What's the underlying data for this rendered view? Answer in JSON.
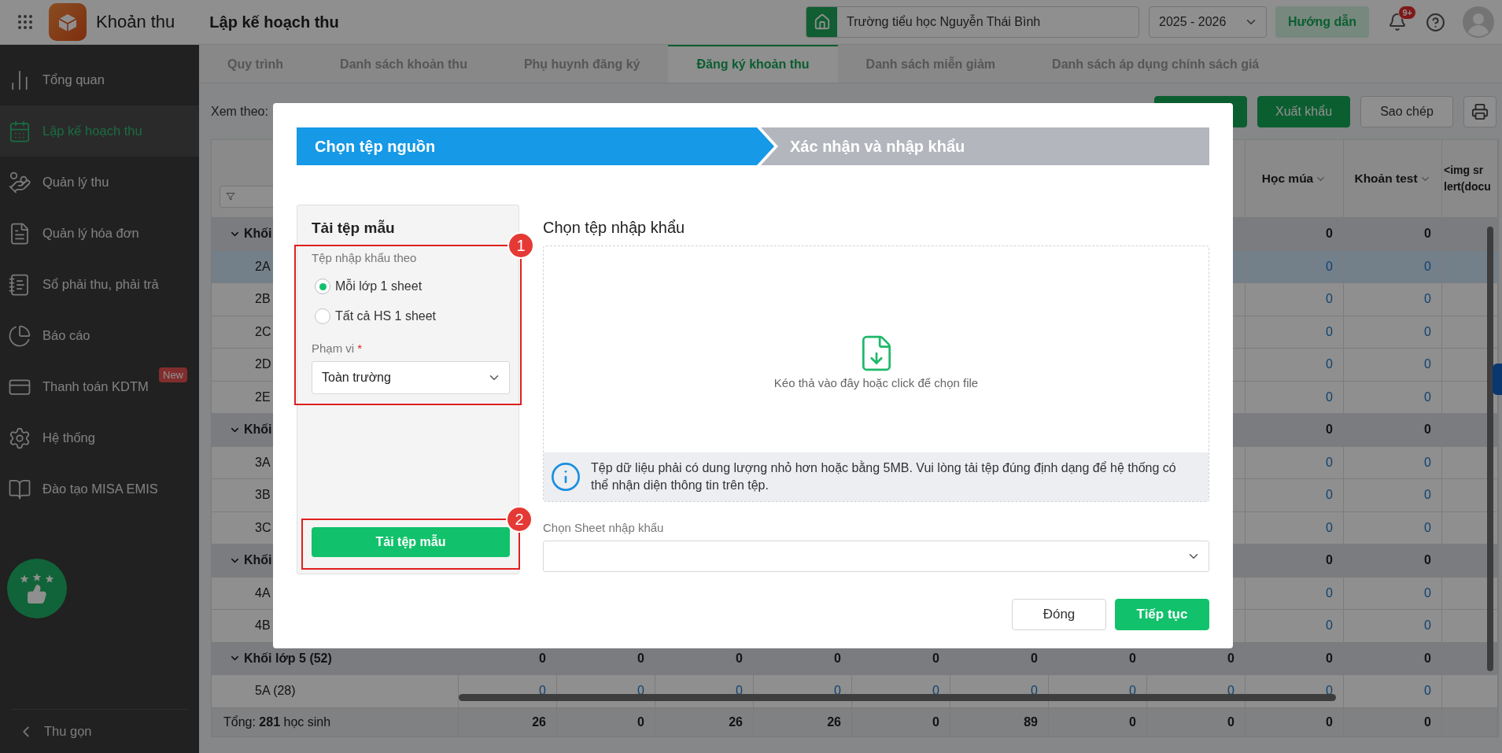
{
  "app": {
    "title": "Khoản thu",
    "page_title": "Lập kế hoạch thu",
    "school": "Trường tiểu học Nguyễn Thái Bình",
    "year": "2025 - 2026",
    "guide_button": "Hướng dẫn",
    "notification_badge": "9+"
  },
  "sidebar": {
    "items": [
      {
        "label": "Tổng quan",
        "selected": false
      },
      {
        "label": "Lập kế hoạch thu",
        "selected": true
      },
      {
        "label": "Quản lý thu",
        "selected": false
      },
      {
        "label": "Quản lý hóa đơn",
        "selected": false
      },
      {
        "label": "Sổ phải thu, phải trả",
        "selected": false
      },
      {
        "label": "Báo cáo",
        "selected": false
      },
      {
        "label": "Thanh toán KDTM",
        "selected": false,
        "badge": "New"
      },
      {
        "label": "Hệ thống",
        "selected": false
      },
      {
        "label": "Đào tạo MISA EMIS",
        "selected": false
      }
    ],
    "collapse": "Thu gọn"
  },
  "tabs": [
    {
      "label": "Quy trình",
      "selected": false
    },
    {
      "label": "Danh sách khoản thu",
      "selected": false
    },
    {
      "label": "Phụ huynh đăng ký",
      "selected": false
    },
    {
      "label": "Đăng ký khoản thu",
      "selected": true
    },
    {
      "label": "Danh sách miễn giảm",
      "selected": false
    },
    {
      "label": "Danh sách áp dụng chính sách giá",
      "selected": false
    }
  ],
  "toolbar": {
    "view_label": "Xem theo:",
    "buttons": [
      {
        "kind": "primary"
      },
      {
        "kind": "primary",
        "label": "Xuất khẩu"
      },
      {
        "kind": "secondary",
        "label": "Sao chép"
      },
      {
        "kind": "icon"
      }
    ]
  },
  "table": {
    "columns": [
      {
        "label": "Học múa"
      },
      {
        "label": "Khoản test"
      },
      {
        "lines": [
          "<img sr",
          "lert(docu"
        ]
      }
    ],
    "rows": [
      {
        "label": "Khối",
        "expanded": true,
        "values": [
          "0",
          "0"
        ],
        "children": [
          {
            "label": "2A",
            "selected": true,
            "values": [
              "0",
              "0"
            ]
          },
          {
            "label": "2B",
            "selected": false,
            "values": [
              "0",
              "0"
            ]
          },
          {
            "label": "2C",
            "selected": false,
            "values": [
              "0",
              "0"
            ]
          },
          {
            "label": "2D",
            "selected": false,
            "values": [
              "0",
              "0"
            ]
          },
          {
            "label": "2E",
            "selected": false,
            "values": [
              "0",
              "0"
            ]
          }
        ]
      },
      {
        "label": "Khối",
        "expanded": true,
        "values": [
          "0",
          "0"
        ],
        "children": [
          {
            "label": "3A",
            "selected": false,
            "values": [
              "0",
              "0"
            ]
          },
          {
            "label": "3B",
            "selected": false,
            "values": [
              "0",
              "0"
            ]
          },
          {
            "label": "3C",
            "selected": false,
            "values": [
              "0",
              "0"
            ]
          }
        ]
      },
      {
        "label": "Khối",
        "expanded": true,
        "values": [
          "0",
          "0"
        ],
        "children": [
          {
            "label": "4A",
            "selected": false,
            "values": [
              "0",
              "0"
            ]
          },
          {
            "label": "4B",
            "selected": false,
            "values": [
              "0",
              "0"
            ]
          }
        ]
      },
      {
        "label": "Khối lớp 5 (52)",
        "expanded": true,
        "values": [
          "0",
          "0",
          "0",
          "0",
          "0",
          "0",
          "0",
          "0",
          "0",
          "0"
        ],
        "children": [
          {
            "label": "5A (28)",
            "selected": false,
            "values": [
              "0",
              "0",
              "0",
              "0",
              "0",
              "0",
              "0",
              "0",
              "0",
              "0"
            ]
          }
        ]
      }
    ],
    "total": {
      "label": "Tổng: **281** học sinh",
      "values": [
        "26",
        "0",
        "26",
        "26",
        "0",
        "89",
        "0",
        "0",
        "0",
        "0"
      ]
    }
  },
  "modal": {
    "steps": [
      {
        "label": "Chọn tệp nguồn",
        "selected": true
      },
      {
        "label": "Xác nhận và nhập khẩu",
        "selected": false
      }
    ],
    "template_panel": {
      "title": "Tải tệp mẫu",
      "mode_label": "Tệp nhập khẩu theo",
      "options": [
        {
          "label": "Mỗi lớp 1 sheet",
          "selected": true
        },
        {
          "label": "Tất cả HS 1 sheet",
          "selected": false
        }
      ],
      "scope_label": "Phạm vi",
      "required_mark": "*",
      "scope_value": "Toàn trường",
      "download_button": "Tải tệp mẫu"
    },
    "import": {
      "title": "Chọn tệp nhập khẩu",
      "drop_hint": "Kéo thả vào đây hoặc click để chọn file",
      "info": "Tệp dữ liệu phải có dung lượng nhỏ hơn hoặc bằng 5MB. Vui lòng tải tệp đúng định dạng để hệ thống có thể nhận diện thông tin trên tệp.",
      "sheet_label": "Chọn Sheet nhập khẩu"
    },
    "buttons": [
      {
        "kind": "secondary",
        "label": "Đóng"
      },
      {
        "kind": "primary",
        "label": "Tiếp tục"
      }
    ],
    "callouts": [
      "1",
      "2"
    ]
  }
}
